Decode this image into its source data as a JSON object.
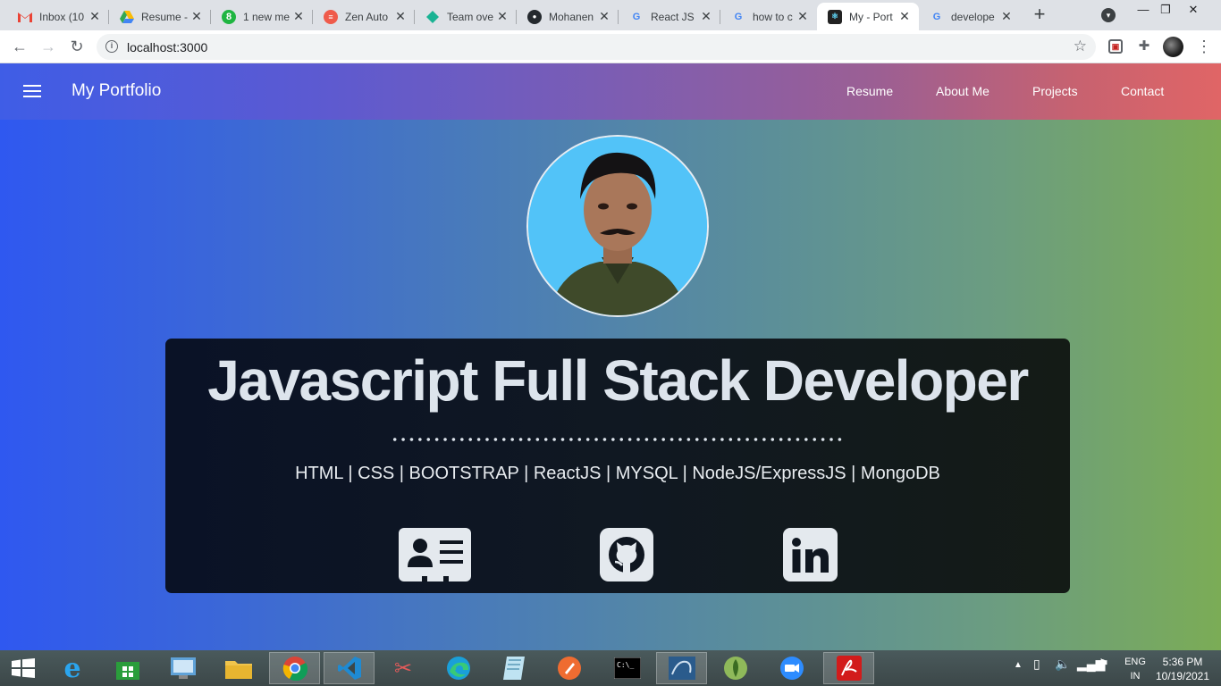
{
  "browser": {
    "tabs": [
      {
        "title": "Inbox (10",
        "icon": "gmail-icon"
      },
      {
        "title": "Resume -",
        "icon": "google-drive-icon"
      },
      {
        "title": "1 new me",
        "icon": "green-app-icon"
      },
      {
        "title": "Zen Auto",
        "icon": "zen-icon"
      },
      {
        "title": "Team ove",
        "icon": "diamond-icon"
      },
      {
        "title": "Mohanen",
        "icon": "github-icon"
      },
      {
        "title": "React JS",
        "icon": "google-icon"
      },
      {
        "title": "how to c",
        "icon": "google-icon"
      },
      {
        "title": "My - Port",
        "icon": "react-icon"
      },
      {
        "title": "develope",
        "icon": "google-icon"
      }
    ],
    "active_tab_index": 8,
    "address": "localhost:3000"
  },
  "site": {
    "brand": "My Portfolio",
    "nav": [
      "Resume",
      "About Me",
      "Projects",
      "Contact"
    ],
    "headline": "Javascript Full Stack Developer",
    "skills": "HTML | CSS | BOOTSTRAP | ReactJS | MYSQL | NodeJS/ExpressJS | MongoDB",
    "social": [
      "contact-card-icon",
      "github-icon",
      "linkedin-icon"
    ]
  },
  "taskbar": {
    "apps": [
      "windows-start-icon",
      "internet-explorer-icon",
      "store-icon",
      "control-panel-icon",
      "file-explorer-icon",
      "chrome-icon",
      "vscode-icon",
      "snipping-tool-icon",
      "edge-icon",
      "notepad-icon",
      "postman-icon",
      "cmd-icon",
      "mysql-workbench-icon",
      "mongodb-compass-icon",
      "zoom-icon",
      "acrobat-icon"
    ],
    "language": "ENG",
    "region": "IN",
    "time": "5:36 PM",
    "date": "10/19/2021"
  },
  "colors": {
    "navbar_start": "#3f5de6",
    "navbar_end": "#e06566",
    "page_start": "#2f58f0",
    "page_end": "#7bac56",
    "card": "#0f1620",
    "headline": "#dde4ec"
  }
}
